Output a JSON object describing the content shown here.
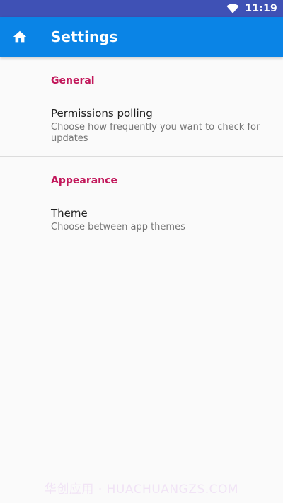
{
  "status_bar": {
    "time": "11:19",
    "wifi_icon": "wifi-icon"
  },
  "app_bar": {
    "title": "Settings",
    "home_icon": "home-icon",
    "color": "#0a84e6"
  },
  "sections": [
    {
      "header": "General",
      "items": [
        {
          "title": "Permissions polling",
          "summary": "Choose how frequently you want to check for updates"
        }
      ]
    },
    {
      "header": "Appearance",
      "items": [
        {
          "title": "Theme",
          "summary": "Choose between app themes"
        }
      ]
    }
  ],
  "colors": {
    "status_bar": "#3f51b5",
    "accent": "#c2185b",
    "background": "#fafafa"
  },
  "watermark": "华创应用 · HUACHUANGZS.COM"
}
